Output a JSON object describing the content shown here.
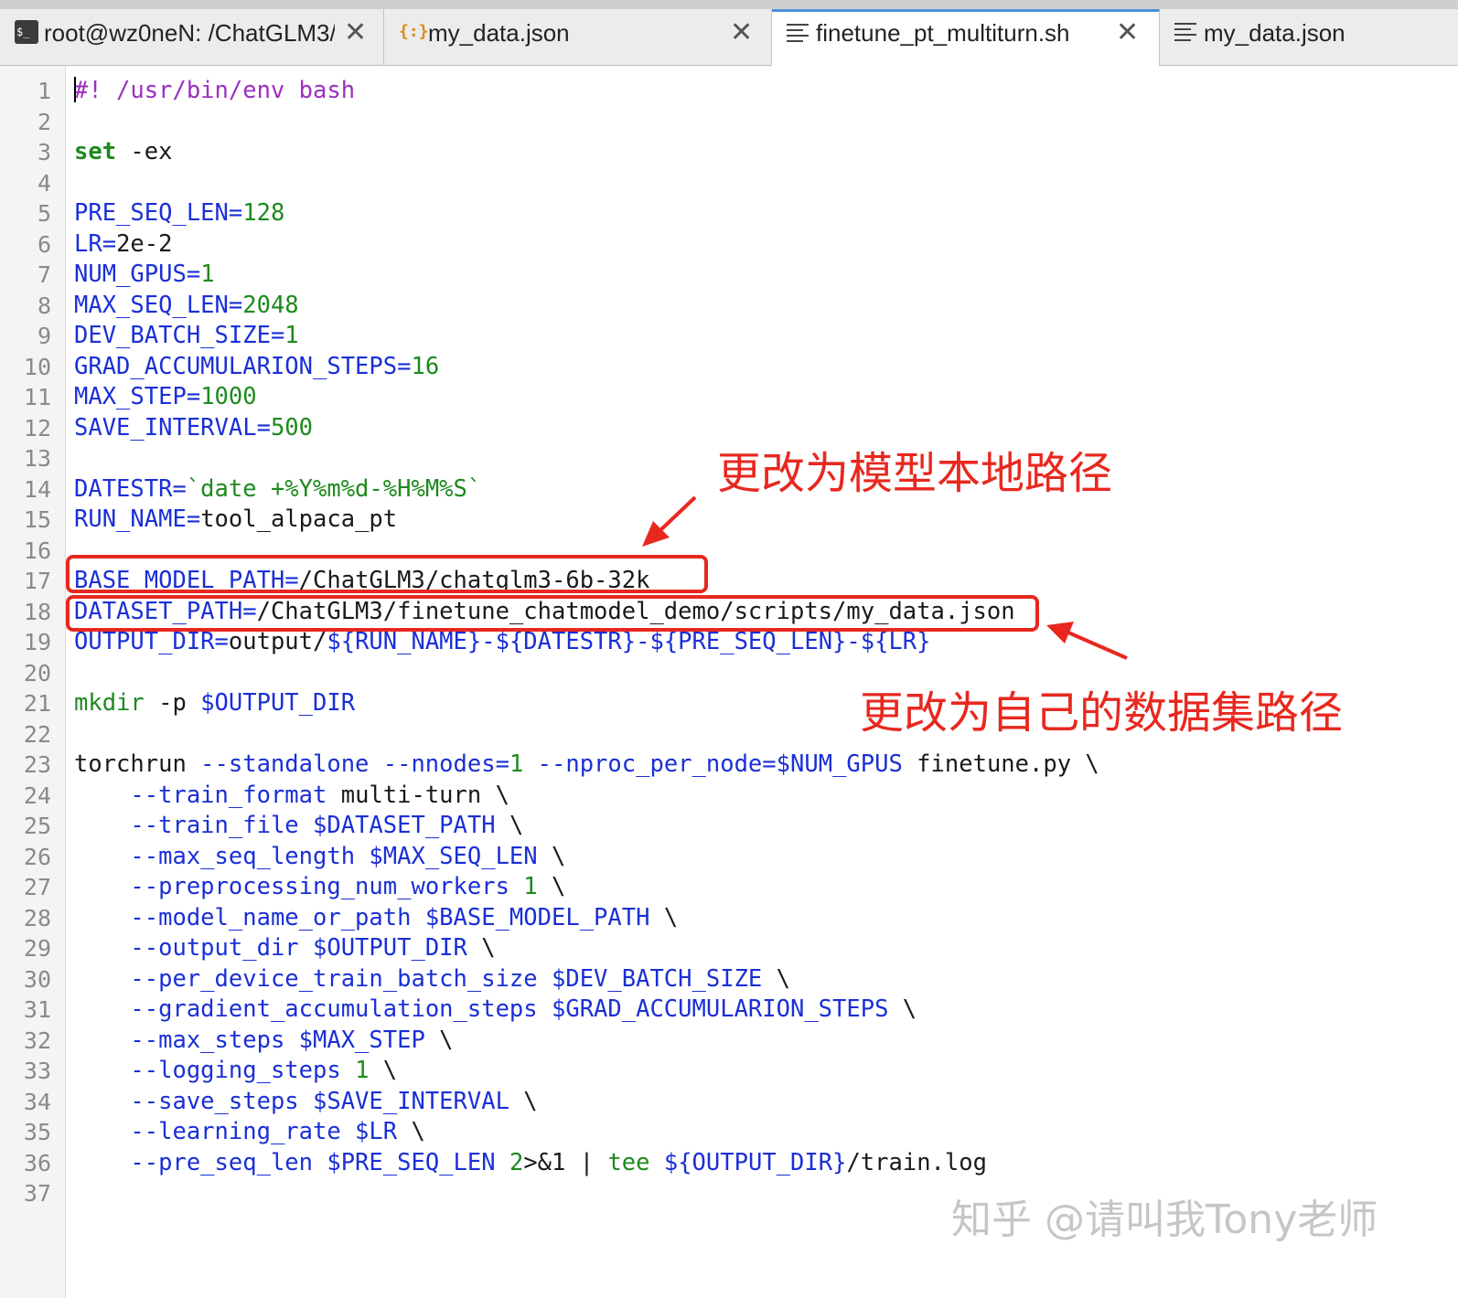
{
  "tabs": [
    {
      "label": "root@wz0neN: /ChatGLM3/",
      "icon": "terminal-icon",
      "active": false,
      "closable": true
    },
    {
      "label": "my_data.json",
      "icon": "json-file-icon",
      "active": false,
      "closable": true
    },
    {
      "label": "finetune_pt_multiturn.sh",
      "icon": "text-file-icon",
      "active": true,
      "closable": true
    },
    {
      "label": "my_data.json",
      "icon": "text-file-icon",
      "active": false,
      "closable": false
    }
  ],
  "close_glyph": "✕",
  "editor": {
    "lines": [
      [
        {
          "t": "#! /usr/bin/env bash",
          "c": "comment"
        }
      ],
      [],
      [
        {
          "t": "set",
          "c": "kw"
        },
        {
          "t": " -ex",
          "c": "plain"
        }
      ],
      [],
      [
        {
          "t": "PRE_SEQ_LEN",
          "c": "var"
        },
        {
          "t": "=",
          "c": "op"
        },
        {
          "t": "128",
          "c": "num"
        }
      ],
      [
        {
          "t": "LR",
          "c": "var"
        },
        {
          "t": "=",
          "c": "op"
        },
        {
          "t": "2e-2",
          "c": "plain"
        }
      ],
      [
        {
          "t": "NUM_GPUS",
          "c": "var"
        },
        {
          "t": "=",
          "c": "op"
        },
        {
          "t": "1",
          "c": "num"
        }
      ],
      [
        {
          "t": "MAX_SEQ_LEN",
          "c": "var"
        },
        {
          "t": "=",
          "c": "op"
        },
        {
          "t": "2048",
          "c": "num"
        }
      ],
      [
        {
          "t": "DEV_BATCH_SIZE",
          "c": "var"
        },
        {
          "t": "=",
          "c": "op"
        },
        {
          "t": "1",
          "c": "num"
        }
      ],
      [
        {
          "t": "GRAD_ACCUMULARION_STEPS",
          "c": "var"
        },
        {
          "t": "=",
          "c": "op"
        },
        {
          "t": "16",
          "c": "num"
        }
      ],
      [
        {
          "t": "MAX_STEP",
          "c": "var"
        },
        {
          "t": "=",
          "c": "op"
        },
        {
          "t": "1000",
          "c": "num"
        }
      ],
      [
        {
          "t": "SAVE_INTERVAL",
          "c": "var"
        },
        {
          "t": "=",
          "c": "op"
        },
        {
          "t": "500",
          "c": "num"
        }
      ],
      [],
      [
        {
          "t": "DATESTR",
          "c": "var"
        },
        {
          "t": "=",
          "c": "op"
        },
        {
          "t": "`date +%Y%m%d-%H%M%S`",
          "c": "str"
        }
      ],
      [
        {
          "t": "RUN_NAME",
          "c": "var"
        },
        {
          "t": "=",
          "c": "op"
        },
        {
          "t": "tool_alpaca_pt",
          "c": "plain"
        }
      ],
      [],
      [
        {
          "t": "BASE_MODEL_PATH",
          "c": "var"
        },
        {
          "t": "=",
          "c": "op"
        },
        {
          "t": "/ChatGLM3/chatglm3-6b-32k",
          "c": "plain"
        }
      ],
      [
        {
          "t": "DATASET_PATH",
          "c": "var"
        },
        {
          "t": "=",
          "c": "op"
        },
        {
          "t": "/ChatGLM3/finetune_chatmodel_demo/scripts/my_data.json",
          "c": "plain"
        }
      ],
      [
        {
          "t": "OUTPUT_DIR",
          "c": "var"
        },
        {
          "t": "=",
          "c": "op"
        },
        {
          "t": "output/",
          "c": "plain"
        },
        {
          "t": "${RUN_NAME}-${DATESTR}-${PRE_SEQ_LEN}-${LR}",
          "c": "var"
        }
      ],
      [],
      [
        {
          "t": "mkdir",
          "c": "func"
        },
        {
          "t": " -p ",
          "c": "plain"
        },
        {
          "t": "$OUTPUT_DIR",
          "c": "var"
        }
      ],
      [],
      [
        {
          "t": "torchrun ",
          "c": "plain"
        },
        {
          "t": "--standalone --nnodes",
          "c": "var"
        },
        {
          "t": "=",
          "c": "op"
        },
        {
          "t": "1",
          "c": "num"
        },
        {
          "t": " --nproc_per_node",
          "c": "var"
        },
        {
          "t": "=",
          "c": "op"
        },
        {
          "t": "$NUM_GPUS",
          "c": "var"
        },
        {
          "t": " finetune.py \\",
          "c": "plain"
        }
      ],
      [
        {
          "t": "    ",
          "c": "plain"
        },
        {
          "t": "--train_format",
          "c": "var"
        },
        {
          "t": " multi-turn \\",
          "c": "plain"
        }
      ],
      [
        {
          "t": "    ",
          "c": "plain"
        },
        {
          "t": "--train_file $DATASET_PATH",
          "c": "var"
        },
        {
          "t": " \\",
          "c": "plain"
        }
      ],
      [
        {
          "t": "    ",
          "c": "plain"
        },
        {
          "t": "--max_seq_length $MAX_SEQ_LEN",
          "c": "var"
        },
        {
          "t": " \\",
          "c": "plain"
        }
      ],
      [
        {
          "t": "    ",
          "c": "plain"
        },
        {
          "t": "--preprocessing_num_workers",
          "c": "var"
        },
        {
          "t": " 1",
          "c": "num"
        },
        {
          "t": " \\",
          "c": "plain"
        }
      ],
      [
        {
          "t": "    ",
          "c": "plain"
        },
        {
          "t": "--model_name_or_path $BASE_MODEL_PATH",
          "c": "var"
        },
        {
          "t": " \\",
          "c": "plain"
        }
      ],
      [
        {
          "t": "    ",
          "c": "plain"
        },
        {
          "t": "--output_dir $OUTPUT_DIR",
          "c": "var"
        },
        {
          "t": " \\",
          "c": "plain"
        }
      ],
      [
        {
          "t": "    ",
          "c": "plain"
        },
        {
          "t": "--per_device_train_batch_size $DEV_BATCH_SIZE",
          "c": "var"
        },
        {
          "t": " \\",
          "c": "plain"
        }
      ],
      [
        {
          "t": "    ",
          "c": "plain"
        },
        {
          "t": "--gradient_accumulation_steps $GRAD_ACCUMULARION_STEPS",
          "c": "var"
        },
        {
          "t": " \\",
          "c": "plain"
        }
      ],
      [
        {
          "t": "    ",
          "c": "plain"
        },
        {
          "t": "--max_steps $MAX_STEP",
          "c": "var"
        },
        {
          "t": " \\",
          "c": "plain"
        }
      ],
      [
        {
          "t": "    ",
          "c": "plain"
        },
        {
          "t": "--logging_steps",
          "c": "var"
        },
        {
          "t": " 1",
          "c": "num"
        },
        {
          "t": " \\",
          "c": "plain"
        }
      ],
      [
        {
          "t": "    ",
          "c": "plain"
        },
        {
          "t": "--save_steps $SAVE_INTERVAL",
          "c": "var"
        },
        {
          "t": " \\",
          "c": "plain"
        }
      ],
      [
        {
          "t": "    ",
          "c": "plain"
        },
        {
          "t": "--learning_rate $LR",
          "c": "var"
        },
        {
          "t": " \\",
          "c": "plain"
        }
      ],
      [
        {
          "t": "    ",
          "c": "plain"
        },
        {
          "t": "--pre_seq_len $PRE_SEQ_LEN",
          "c": "var"
        },
        {
          "t": " 2",
          "c": "num"
        },
        {
          "t": ">&1 | ",
          "c": "plain"
        },
        {
          "t": "tee",
          "c": "func"
        },
        {
          "t": " ${OUTPUT_DIR}",
          "c": "var"
        },
        {
          "t": "/train.log",
          "c": "plain"
        }
      ],
      []
    ]
  },
  "annotations": {
    "model_path_note": "更改为模型本地路径",
    "dataset_path_note": "更改为自己的数据集路径"
  },
  "watermark": "知乎 @请叫我Tony老师",
  "colors": {
    "annotation_red": "#e8281f",
    "comment": "#9b2fbf",
    "keyword": "#1d8a1d",
    "variable": "#1a2fd6",
    "active_tab_accent": "#4a90d9"
  }
}
